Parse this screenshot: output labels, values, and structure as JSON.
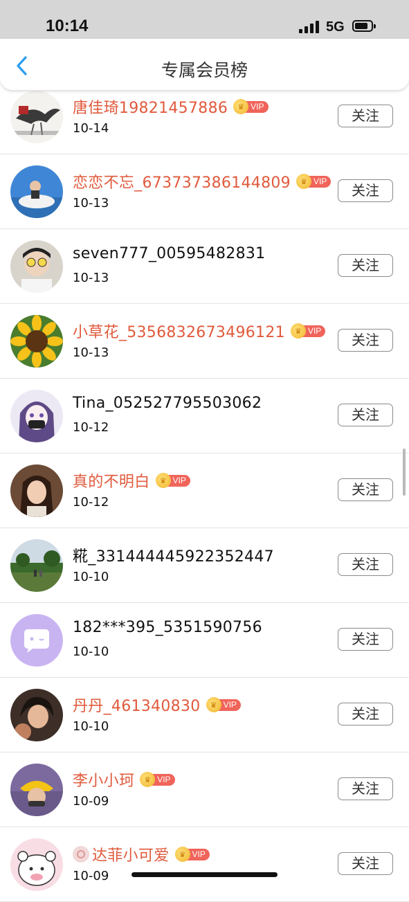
{
  "status_bar": {
    "time": "10:14",
    "network": "5G"
  },
  "nav": {
    "title": "专属会员榜"
  },
  "vip_label": "VIP",
  "colors": {
    "vip_name": "#e05a3c",
    "vip_tag": "#f0645a",
    "crown": "#f1b42a"
  },
  "members": [
    {
      "name": "唐佳琦19821457886",
      "date": "10-14",
      "vip": true,
      "follow_label": "关注",
      "avatar": "ink-eagle-painting"
    },
    {
      "name": "恋恋不忘_673737386144809",
      "date": "10-13",
      "vip": true,
      "follow_label": "关注",
      "avatar": "child-on-boat-photo"
    },
    {
      "name": "seven777_00595482831",
      "date": "10-13",
      "vip": false,
      "follow_label": "关注",
      "avatar": "man-with-glasses-photo"
    },
    {
      "name": "小草花_5356832673496121",
      "date": "10-13",
      "vip": true,
      "follow_label": "关注",
      "avatar": "sunflower-photo"
    },
    {
      "name": "Tina_052527795503062",
      "date": "10-12",
      "vip": false,
      "follow_label": "关注",
      "avatar": "anime-girl"
    },
    {
      "name": "真的不明白",
      "date": "10-12",
      "vip": true,
      "follow_label": "关注",
      "avatar": "girl-photo"
    },
    {
      "name": "糀_331444445922352447",
      "date": "10-10",
      "vip": false,
      "follow_label": "关注",
      "avatar": "park-photo"
    },
    {
      "name": "182***395_5351590756",
      "date": "10-10",
      "vip": false,
      "follow_label": "关注",
      "avatar": "default-chat-avatar"
    },
    {
      "name": "丹丹_461340830",
      "date": "10-10",
      "vip": true,
      "follow_label": "关注",
      "avatar": "woman-selfie-photo"
    },
    {
      "name": "李小小珂",
      "date": "10-09",
      "vip": true,
      "follow_label": "关注",
      "avatar": "child-yellow-hat-photo"
    },
    {
      "name": "达菲小可爱",
      "date": "10-09",
      "vip": true,
      "follow_label": "关注",
      "avatar": "cartoon-bear",
      "prefix_icon": "sticker-icon"
    }
  ]
}
